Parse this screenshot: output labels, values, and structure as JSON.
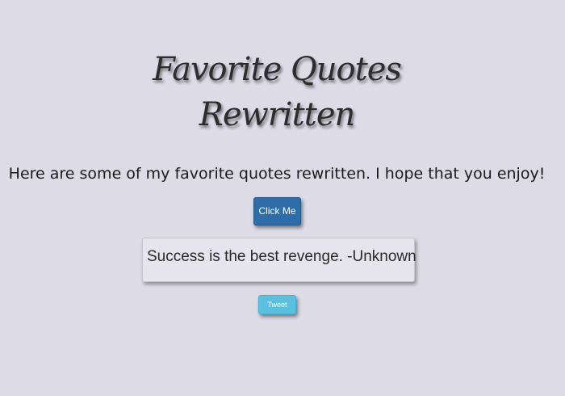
{
  "header": {
    "title_line1": "Favorite Quotes",
    "title_line2": "Rewritten"
  },
  "intro": {
    "text": "Here are some of my favorite quotes rewritten. I hope that you enjoy!"
  },
  "actions": {
    "click_label": "Click Me",
    "tweet_label": "Tweet"
  },
  "quote": {
    "text": "Success is the best revenge. -Unknown"
  },
  "colors": {
    "background": "#dcdbe6",
    "primary_button": "#2e6da8",
    "tweet_button": "#5bc0de"
  }
}
